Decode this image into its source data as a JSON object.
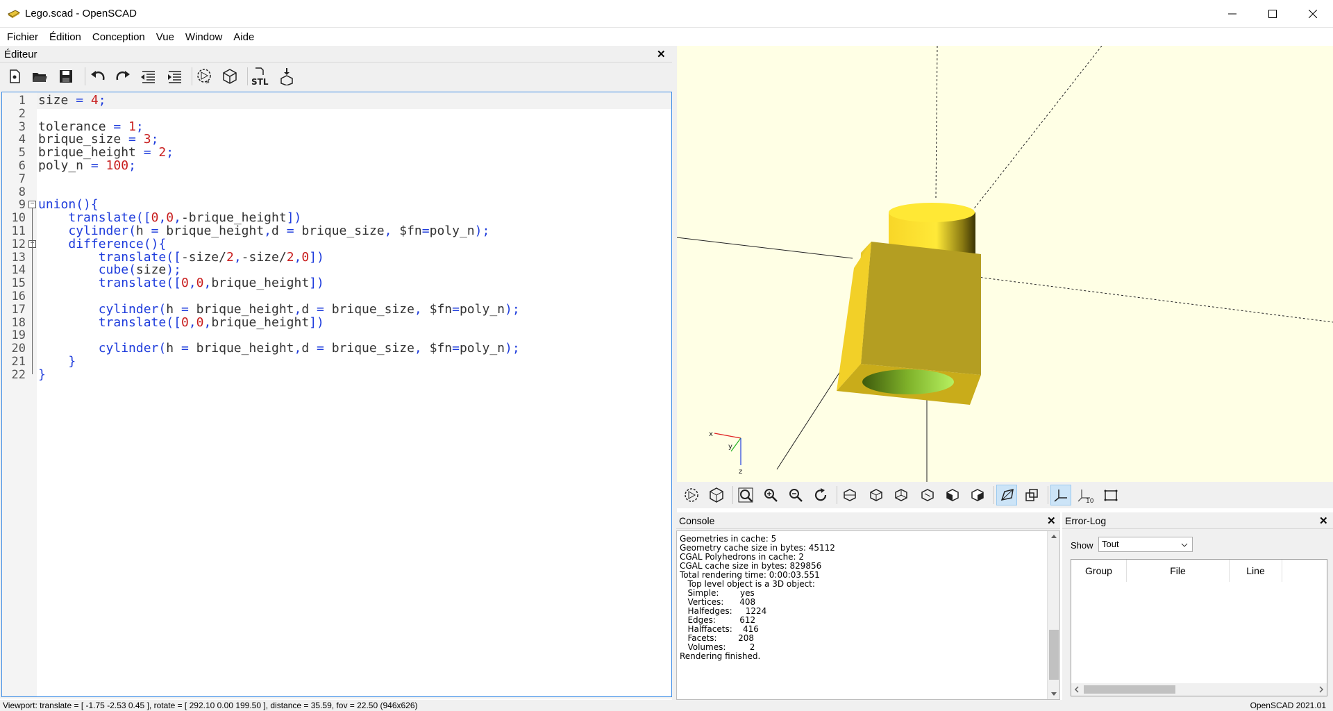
{
  "window": {
    "title": "Lego.scad - OpenSCAD"
  },
  "menubar": [
    "Fichier",
    "Édition",
    "Conception",
    "Vue",
    "Window",
    "Aide"
  ],
  "editor": {
    "title": "Éditeur",
    "close": "✕",
    "line_numbers": [
      "1",
      "2",
      "3",
      "4",
      "5",
      "6",
      "7",
      "8",
      "9",
      "10",
      "11",
      "12",
      "13",
      "14",
      "15",
      "16",
      "17",
      "18",
      "19",
      "20",
      "21",
      "22"
    ],
    "lines": [
      "size = 4;",
      "",
      "tolerance = 1;",
      "brique_size = 3;",
      "brique_height = 2;",
      "poly_n = 100;",
      "",
      "",
      "union(){",
      "    translate([0,0,-brique_height])",
      "    cylinder(h = brique_height,d = brique_size, $fn=poly_n);",
      "    difference(){",
      "        translate([-size/2,-size/2,0])",
      "        cube(size);",
      "        translate([0,0,brique_height])",
      "",
      "        cylinder(h = brique_height,d = brique_size, $fn=poly_n);",
      "        translate([0,0,brique_height])",
      "",
      "        cylinder(h = brique_height,d = brique_size, $fn=poly_n);",
      "    }",
      "}"
    ],
    "toolbar": {
      "new": "new-file-icon",
      "open": "open-folder-icon",
      "save": "save-icon",
      "undo": "undo-icon",
      "redo": "redo-icon",
      "unindent": "unindent-icon",
      "indent": "indent-icon",
      "preview": "preview-icon",
      "render": "render-icon",
      "export_stl": "STL",
      "send": "send-to-print-icon"
    }
  },
  "viewport": {
    "axis_x": "x",
    "axis_y": "y",
    "axis_z": "z"
  },
  "console": {
    "title": "Console",
    "close": "✕",
    "lines": [
      "Geometries in cache: 5",
      "Geometry cache size in bytes: 45112",
      "CGAL Polyhedrons in cache: 2",
      "CGAL cache size in bytes: 829856",
      "Total rendering time: 0:00:03.551",
      "   Top level object is a 3D object:",
      "   Simple:        yes",
      "   Vertices:      408",
      "   Halfedges:     1224",
      "   Edges:         612",
      "   Halffacets:    416",
      "   Facets:        208",
      "   Volumes:         2",
      "Rendering finished."
    ]
  },
  "errorlog": {
    "title": "Error-Log",
    "close": "✕",
    "show_label": "Show",
    "show_value": "Tout",
    "columns": [
      "Group",
      "File",
      "Line"
    ]
  },
  "statusbar": {
    "viewport": "Viewport: translate = [ -1.75 -2.53 0.45 ], rotate = [ 292.10 0.00 199.50 ], distance = 35.59, fov = 22.50 (946x626)",
    "version": "OpenSCAD 2021.01"
  },
  "colors": {
    "accent": "#3c8ce6",
    "viewport_bg": "#ffffe5",
    "object": "#f5d22a",
    "object_dark": "#b09a1e",
    "hole": "#9ad84a"
  }
}
